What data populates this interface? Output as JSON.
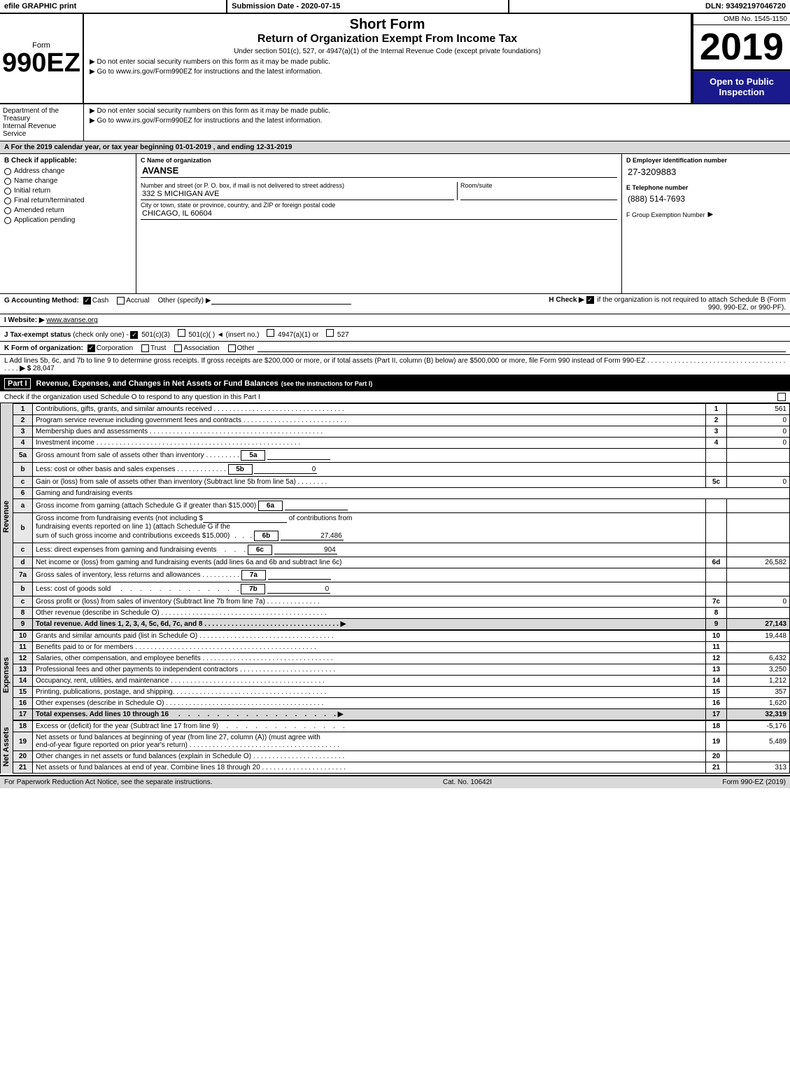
{
  "topbar": {
    "efile": "efile GRAPHIC print",
    "submission": "Submission Date - 2020-07-15",
    "dln": "DLN: 93492197046720"
  },
  "header": {
    "dept_line1": "Department of the",
    "dept_line2": "Treasury",
    "dept_line3": "Internal Revenue",
    "dept_line4": "Service",
    "form_number": "990EZ",
    "short_form": "Short Form",
    "return_title": "Return of Organization Exempt From Income Tax",
    "under_section": "Under section 501(c), 527, or 4947(a)(1) of the Internal Revenue Code (except private foundations)",
    "instruction1": "▶ Do not enter social security numbers on this form as it may be made public.",
    "instruction2": "▶ Go to www.irs.gov/Form990EZ for instructions and the latest information.",
    "year": "2019",
    "open_to_public": "Open to Public Inspection",
    "omb": "OMB No. 1545-1150"
  },
  "section_a": {
    "text": "A  For the 2019 calendar year, or tax year beginning 01-01-2019 , and ending 12-31-2019"
  },
  "section_b": {
    "title": "B  Check if applicable:",
    "items": [
      {
        "label": "Address change",
        "checked": false
      },
      {
        "label": "Name change",
        "checked": false
      },
      {
        "label": "Initial return",
        "checked": false
      },
      {
        "label": "Final return/terminated",
        "checked": false
      },
      {
        "label": "Amended return",
        "checked": false
      },
      {
        "label": "Application pending",
        "checked": false
      }
    ]
  },
  "org": {
    "c_label": "C Name of organization",
    "name": "AVANSE",
    "address_label": "Number and street (or P. O. box, if mail is not delivered to street address)",
    "address": "332 S MICHIGAN AVE",
    "room_suite_label": "Room/suite",
    "room_suite": "",
    "city_label": "City or town, state or province, country, and ZIP or foreign postal code",
    "city": "CHICAGO, IL  60604",
    "d_label": "D Employer identification number",
    "ein": "27-3209883",
    "e_label": "E Telephone number",
    "phone": "(888) 514-7693",
    "f_label": "F Group Exemption Number",
    "group_exemption": ""
  },
  "accounting": {
    "g_label": "G Accounting Method:",
    "cash": "Cash",
    "accrual": "Accrual",
    "other": "Other (specify) ▶",
    "cash_checked": true,
    "h_label": "H  Check ▶",
    "h_text": "if the organization is not required to attach Schedule B (Form 990, 990-EZ, or 990-PF).",
    "h_checked": true
  },
  "website": {
    "i_label": "I Website: ▶",
    "url": "www.avanse.org"
  },
  "tax_exempt": {
    "j_label": "J Tax-exempt status",
    "check_only": "(check only one) -",
    "options": [
      "501(c)(3)",
      "501(c)(",
      ")  ◄ (insert no.)",
      "4947(a)(1) or",
      "527"
    ],
    "selected": "501(c)(3)"
  },
  "form_org": {
    "k_label": "K Form of organization:",
    "corp": "Corporation",
    "trust": "Trust",
    "assoc": "Association",
    "other": "Other",
    "selected": "Corporation"
  },
  "l_line": {
    "text": "L Add lines 5b, 6c, and 7b to line 9 to determine gross receipts. If gross receipts are $200,000 or more, or if total assets (Part II, column (B) below) are $500,000 or more, file Form 990 instead of Form 990-EZ",
    "dotdot": ". . . . . . . . . . . . . . . . . . . . . . . . . . . . . . . . . . . . . . .",
    "arrow": "▶ $",
    "value": "28,047"
  },
  "part1": {
    "title": "Part I",
    "title2": "Revenue, Expenses, and Changes in Net Assets or Fund Balances",
    "see_instructions": "(see the instructions for Part I)",
    "schedule_o_text": "Check if the organization used Schedule O to respond to any question in this Part I",
    "rows": [
      {
        "num": "1",
        "desc": "Contributions, gifts, grants, and similar amounts received",
        "ref": "1",
        "value": "561"
      },
      {
        "num": "2",
        "desc": "Program service revenue including government fees and contracts",
        "ref": "2",
        "value": "0"
      },
      {
        "num": "3",
        "desc": "Membership dues and assessments",
        "ref": "3",
        "value": "0"
      },
      {
        "num": "4",
        "desc": "Investment income",
        "ref": "4",
        "value": "0"
      },
      {
        "num": "5a",
        "desc": "Gross amount from sale of assets other than inventory",
        "ref": "5a",
        "value": ""
      },
      {
        "num": "5b",
        "desc": "Less: cost or other basis and sales expenses",
        "ref": "5b",
        "value": "0"
      },
      {
        "num": "5c",
        "desc": "Gain or (loss) from sale of assets other than inventory (Subtract line 5b from line 5a)",
        "ref": "5c",
        "value": "0"
      },
      {
        "num": "6",
        "desc": "Gaming and fundraising events",
        "ref": "",
        "value": ""
      },
      {
        "num": "6a",
        "desc": "Gross income from gaming (attach Schedule G if greater than $15,000)",
        "ref": "6a",
        "value": ""
      },
      {
        "num": "6b",
        "desc": "Gross income from fundraising events (not including $______ of contributions from fundraising events reported on line 1) (attach Schedule G if the sum of such gross income and contributions exceeds $15,000)",
        "ref": "6b",
        "value": "27,486"
      },
      {
        "num": "6c",
        "desc": "Less: direct expenses from gaming and fundraising events",
        "ref": "6c",
        "value": "904"
      },
      {
        "num": "6d",
        "desc": "Net income or (loss) from gaming and fundraising events (add lines 6a and 6b and subtract line 6c)",
        "ref": "6d",
        "value": "26,582"
      },
      {
        "num": "7a",
        "desc": "Gross sales of inventory, less returns and allowances",
        "ref": "7a",
        "value": ""
      },
      {
        "num": "7b",
        "desc": "Less: cost of goods sold",
        "ref": "7b",
        "value": "0"
      },
      {
        "num": "7c",
        "desc": "Gross profit or (loss) from sales of inventory (Subtract line 7b from line 7a)",
        "ref": "7c",
        "value": "0"
      },
      {
        "num": "8",
        "desc": "Other revenue (describe in Schedule O)",
        "ref": "8",
        "value": ""
      },
      {
        "num": "9",
        "desc": "Total revenue. Add lines 1, 2, 3, 4, 5c, 6d, 7c, and 8",
        "ref": "9",
        "value": "27,143",
        "bold": true
      }
    ]
  },
  "expenses": {
    "rows": [
      {
        "num": "10",
        "desc": "Grants and similar amounts paid (list in Schedule O)",
        "ref": "10",
        "value": "19,448"
      },
      {
        "num": "11",
        "desc": "Benefits paid to or for members",
        "ref": "11",
        "value": ""
      },
      {
        "num": "12",
        "desc": "Salaries, other compensation, and employee benefits",
        "ref": "12",
        "value": "6,432"
      },
      {
        "num": "13",
        "desc": "Professional fees and other payments to independent contractors",
        "ref": "13",
        "value": "3,250"
      },
      {
        "num": "14",
        "desc": "Occupancy, rent, utilities, and maintenance",
        "ref": "14",
        "value": "1,212"
      },
      {
        "num": "15",
        "desc": "Printing, publications, postage, and shipping",
        "ref": "15",
        "value": "357"
      },
      {
        "num": "16",
        "desc": "Other expenses (describe in Schedule O)",
        "ref": "16",
        "value": "1,620"
      },
      {
        "num": "17",
        "desc": "Total expenses. Add lines 10 through 16",
        "ref": "17",
        "value": "32,319",
        "bold": true,
        "arrow": true
      }
    ]
  },
  "net_assets_rows": [
    {
      "num": "18",
      "desc": "Excess or (deficit) for the year (Subtract line 17 from line 9)",
      "ref": "18",
      "value": "-5,176"
    },
    {
      "num": "19",
      "desc": "Net assets or fund balances at beginning of year (from line 27, column (A)) (must agree with end-of-year figure reported on prior year's return)",
      "ref": "19",
      "value": "5,489"
    },
    {
      "num": "20",
      "desc": "Other changes in net assets or fund balances (explain in Schedule O)",
      "ref": "20",
      "value": ""
    },
    {
      "num": "21",
      "desc": "Net assets or fund balances at end of year. Combine lines 18 through 20",
      "ref": "21",
      "value": "313"
    }
  ],
  "footer": {
    "left": "For Paperwork Reduction Act Notice, see the separate instructions.",
    "cat": "Cat. No. 10642I",
    "right": "Form 990-EZ (2019)"
  }
}
